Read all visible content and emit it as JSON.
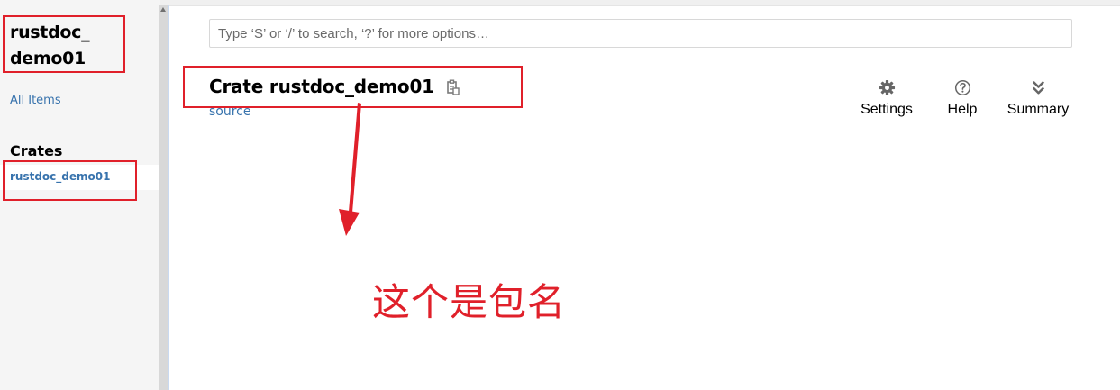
{
  "sidebar": {
    "crate_title_line1": "rustdoc_",
    "crate_title_line2": "demo01",
    "all_items": "All Items",
    "crates_heading": "Crates",
    "crates": [
      "rustdoc_demo01"
    ]
  },
  "search": {
    "placeholder": "Type ‘S’ or ‘/’ to search, ‘?’ for more options…"
  },
  "main": {
    "title": "Crate rustdoc_demo01",
    "source_label": "source"
  },
  "toolbar": {
    "settings_label": "Settings",
    "help_label": "Help",
    "summary_label": "Summary"
  },
  "annotation": {
    "text": "这个是包名",
    "color": "#e0202a"
  },
  "colors": {
    "link": "#3873ad",
    "sidebar_bg": "#f5f5f5"
  },
  "icons": {
    "copy": "clipboard-copy-icon",
    "settings": "gear-icon",
    "help": "question-circle-icon",
    "summary": "double-chevron-down-icon"
  }
}
